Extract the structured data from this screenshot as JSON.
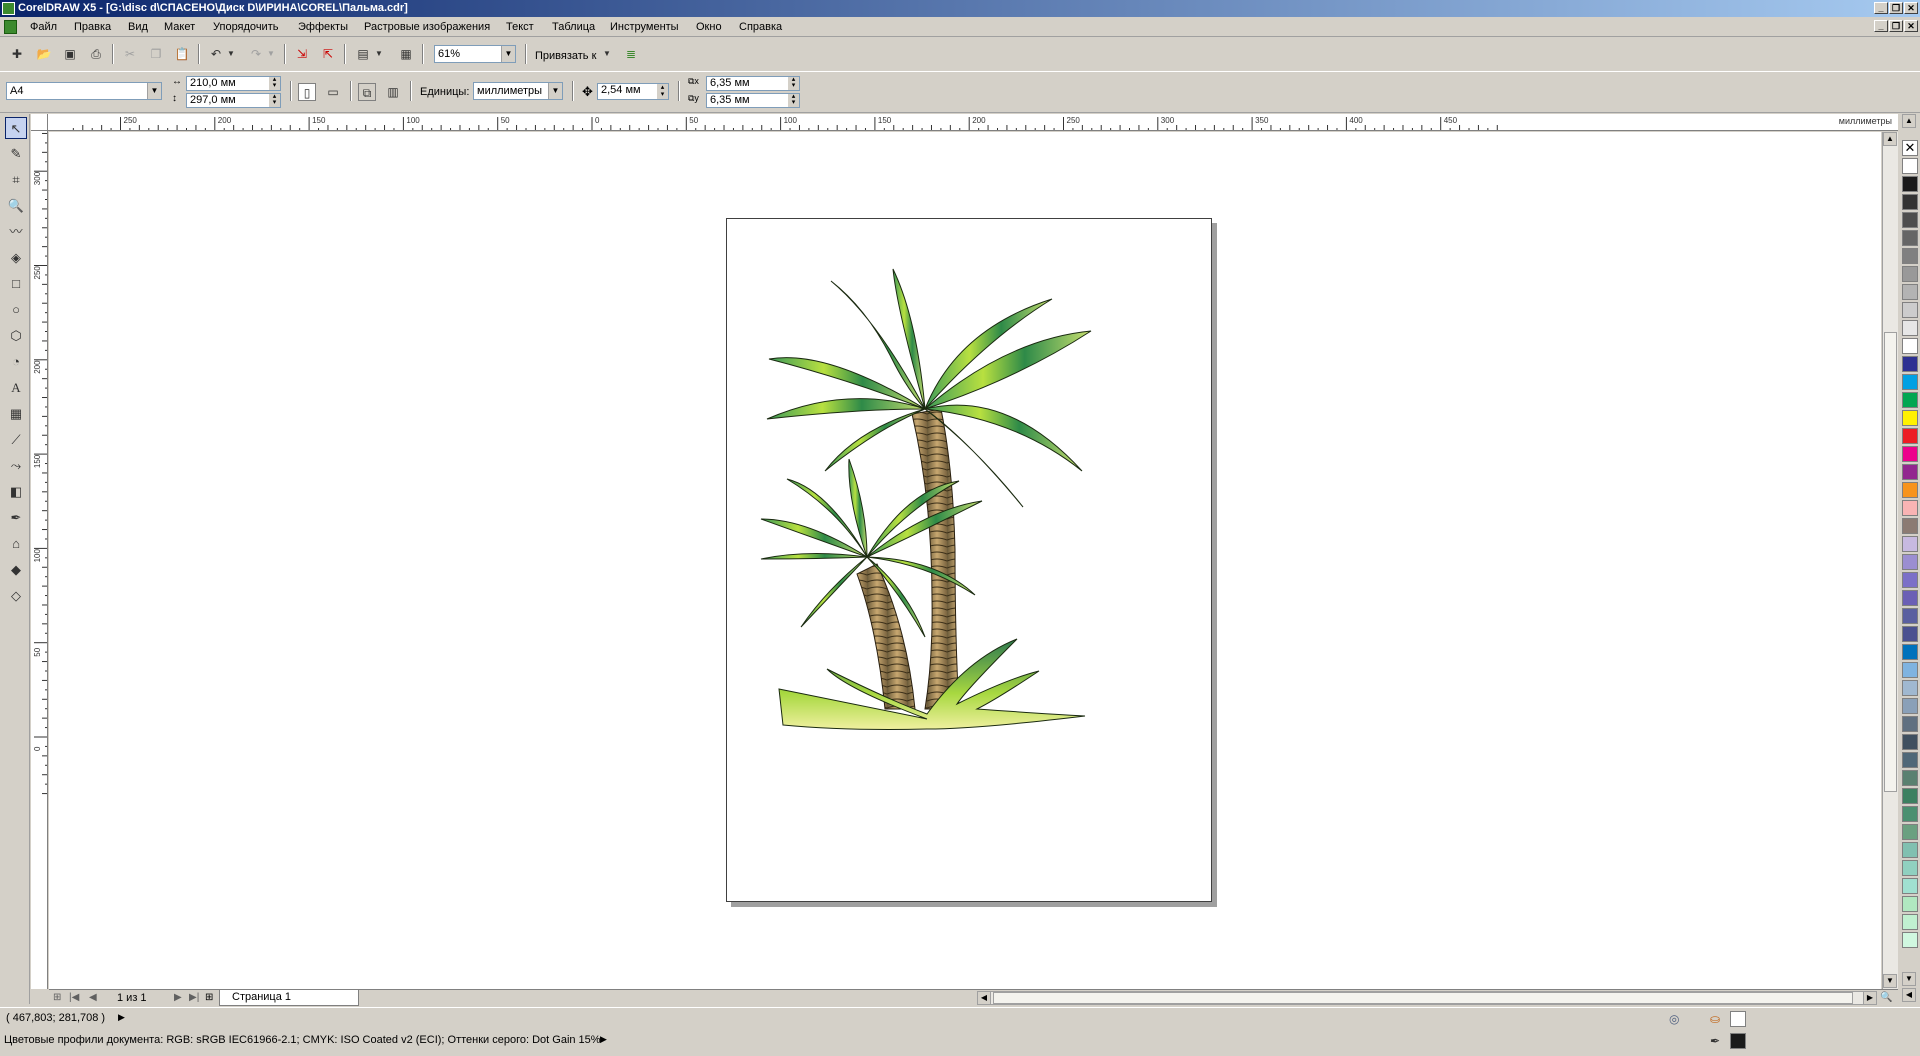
{
  "window": {
    "title": "CorelDRAW X5 - [G:\\disc d\\СПАСЕНО\\Диск D\\ИРИНА\\COREL\\Пальма.cdr]",
    "min": "_",
    "restore": "❐",
    "close": "✕"
  },
  "menu": [
    "Файл",
    "Правка",
    "Вид",
    "Макет",
    "Упорядочить",
    "Эффекты",
    "Растровые изображения",
    "Текст",
    "Таблица",
    "Инструменты",
    "Окно",
    "Справка"
  ],
  "toolbar": {
    "zoom": "61%",
    "snap_label": "Привязать к"
  },
  "propbar": {
    "paper": "A4",
    "width": "210,0 мм",
    "height": "297,0 мм",
    "units_label": "Единицы:",
    "units_value": "миллиметры",
    "nudge": "2,54 мм",
    "dup_x": "6,35 мм",
    "dup_y": "6,35 мм"
  },
  "rulers": {
    "unit": "миллиметры",
    "h_ticks": [
      "250",
      "200",
      "150",
      "100",
      "50",
      "0",
      "50",
      "100",
      "150",
      "200",
      "250",
      "300",
      "350",
      "400",
      "450"
    ],
    "v_ticks": [
      "300",
      "250",
      "200",
      "150",
      "100",
      "50",
      "0"
    ]
  },
  "navigator": {
    "page_count": "1 из 1",
    "page_tab": "Страница 1"
  },
  "status": {
    "coords": "( 467,803; 281,708 )",
    "profile": "Цветовые профили документа: RGB: sRGB IEC61966-2.1; CMYK: ISO Coated v2 (ECI); Оттенки серого: Dot Gain 15%"
  },
  "palette": [
    "#ffffff",
    "#1a1a1a",
    "#333333",
    "#4d4d4d",
    "#666666",
    "#808080",
    "#999999",
    "#b3b3b3",
    "#cccccc",
    "#e6e6e6",
    "#ffffff",
    "#2e3192",
    "#00a0e3",
    "#00a651",
    "#fff200",
    "#ed1c24",
    "#ec008c",
    "#92278f",
    "#f7941d",
    "#f9b4b4",
    "#8c7b73",
    "#c7b9e0",
    "#9b8ed1",
    "#7b6fc7",
    "#6b5fb5",
    "#5a5fa0",
    "#4a5090",
    "#0072bc",
    "#7fb3e0",
    "#a0b8d0",
    "#8aa0b8",
    "#607080",
    "#405060",
    "#506878",
    "#5a8070",
    "#3c8060",
    "#4a9070",
    "#6aa080",
    "#80c0b0",
    "#90d0c0",
    "#a0e0d0",
    "#b0e8c0",
    "#c0f0d0",
    "#d0f8e0"
  ]
}
